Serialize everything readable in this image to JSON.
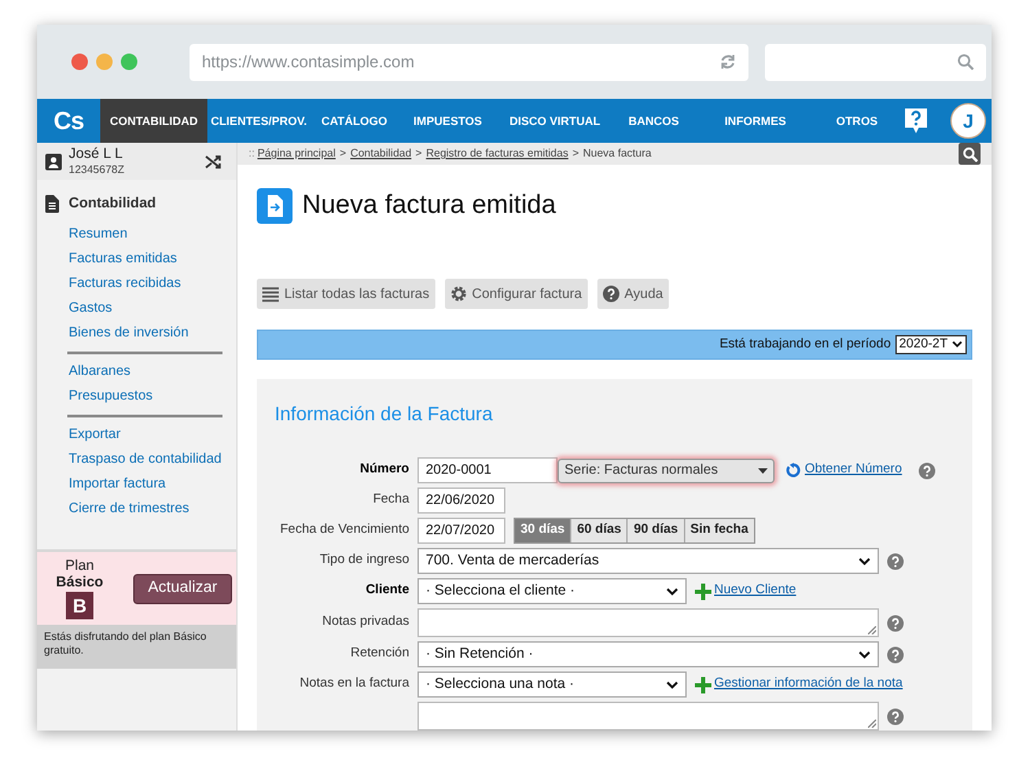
{
  "browser": {
    "url": "https://www.contasimple.com"
  },
  "nav": {
    "logo": "Cs",
    "items": [
      {
        "label": "CONTABILIDAD",
        "selected": true
      },
      {
        "label": "CLIENTES/PROV.",
        "selected": false
      },
      {
        "label": "CATÁLOGO",
        "selected": false
      },
      {
        "label": "IMPUESTOS",
        "selected": false
      },
      {
        "label": "DISCO VIRTUAL",
        "selected": false
      },
      {
        "label": "BANCOS",
        "selected": false
      },
      {
        "label": "INFORMES",
        "selected": false
      },
      {
        "label": "OTROS",
        "selected": false
      }
    ],
    "avatar": "J"
  },
  "user": {
    "name": "José L L",
    "id": "12345678Z"
  },
  "breadcrumb": {
    "prefix": "::",
    "separator": ">",
    "links": [
      "Página principal",
      "Contabilidad",
      "Registro de facturas emitidas"
    ],
    "current": "Nueva factura"
  },
  "sidebar": {
    "title": "Contabilidad",
    "groups": [
      [
        "Resumen",
        "Facturas emitidas",
        "Facturas recibidas",
        "Gastos",
        "Bienes de inversión"
      ],
      [
        "Albaranes",
        "Presupuestos"
      ],
      [
        "Exportar",
        "Traspaso de contabilidad",
        "Importar factura",
        "Cierre de trimestres"
      ]
    ],
    "plan": {
      "label": "Plan",
      "name": "Básico",
      "badge": "B",
      "button": "Actualizar",
      "note": "Estás disfrutando del plan Básico gratuito."
    }
  },
  "page": {
    "title": "Nueva factura emitida",
    "toolbar": [
      {
        "kind": "list",
        "label": "Listar todas las facturas"
      },
      {
        "kind": "gear",
        "label": "Configurar factura"
      },
      {
        "kind": "help",
        "label": "Ayuda"
      }
    ],
    "period": {
      "label": "Está trabajando en el período",
      "value": "2020-2T"
    }
  },
  "form": {
    "title": "Información de la Factura",
    "rows": [
      {
        "kind": "number",
        "label": "Número",
        "required": true,
        "value": "2020-0001",
        "series": "Serie: Facturas normales",
        "link": "Obtener Número",
        "help": true
      },
      {
        "kind": "date",
        "label": "Fecha",
        "required": false,
        "value": "22/06/2020"
      },
      {
        "kind": "due",
        "label": "Fecha de Vencimiento",
        "required": false,
        "value": "22/07/2020",
        "options": [
          {
            "label": "30 días",
            "selected": true
          },
          {
            "label": "60 días",
            "selected": false
          },
          {
            "label": "90 días",
            "selected": false
          },
          {
            "label": "Sin fecha",
            "selected": false
          }
        ]
      },
      {
        "kind": "select",
        "label": "Tipo de ingreso",
        "required": false,
        "value": "700. Venta de mercaderías",
        "help": true
      },
      {
        "kind": "select-link",
        "label": "Cliente",
        "required": true,
        "value": "· Selecciona el cliente ·",
        "link": "Nuevo Cliente"
      },
      {
        "kind": "textarea",
        "label": "Notas privadas",
        "required": false,
        "help": true
      },
      {
        "kind": "select",
        "label": "Retención",
        "required": false,
        "value": "· Sin Retención ·",
        "help": true
      },
      {
        "kind": "select-link",
        "label": "Notas en la factura",
        "required": false,
        "value": "· Selecciona una nota ·",
        "link": "Gestionar información de la nota"
      },
      {
        "kind": "textarea",
        "help": true
      }
    ]
  }
}
